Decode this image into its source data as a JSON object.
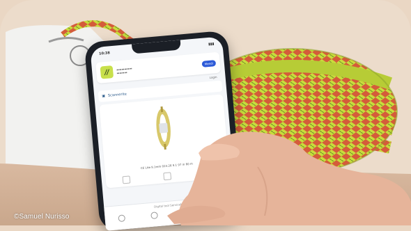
{
  "photo": {
    "credit": "©Samuel Nurisso"
  },
  "phone_ui": {
    "status_time": "10:38",
    "badge": "Mendi",
    "logout": "Login",
    "scanner_label": "Scannerite",
    "product_description": "CE Lite 9.1mm 023.28 9.1 97 in 60 m",
    "footer_text": "Digital tool ServiceNow"
  },
  "colors": {
    "rope_lime": "#c8dc3c",
    "rope_red": "#d6453a",
    "background_peach": "#ead7c4",
    "phone_accent": "#2d5bd8"
  }
}
